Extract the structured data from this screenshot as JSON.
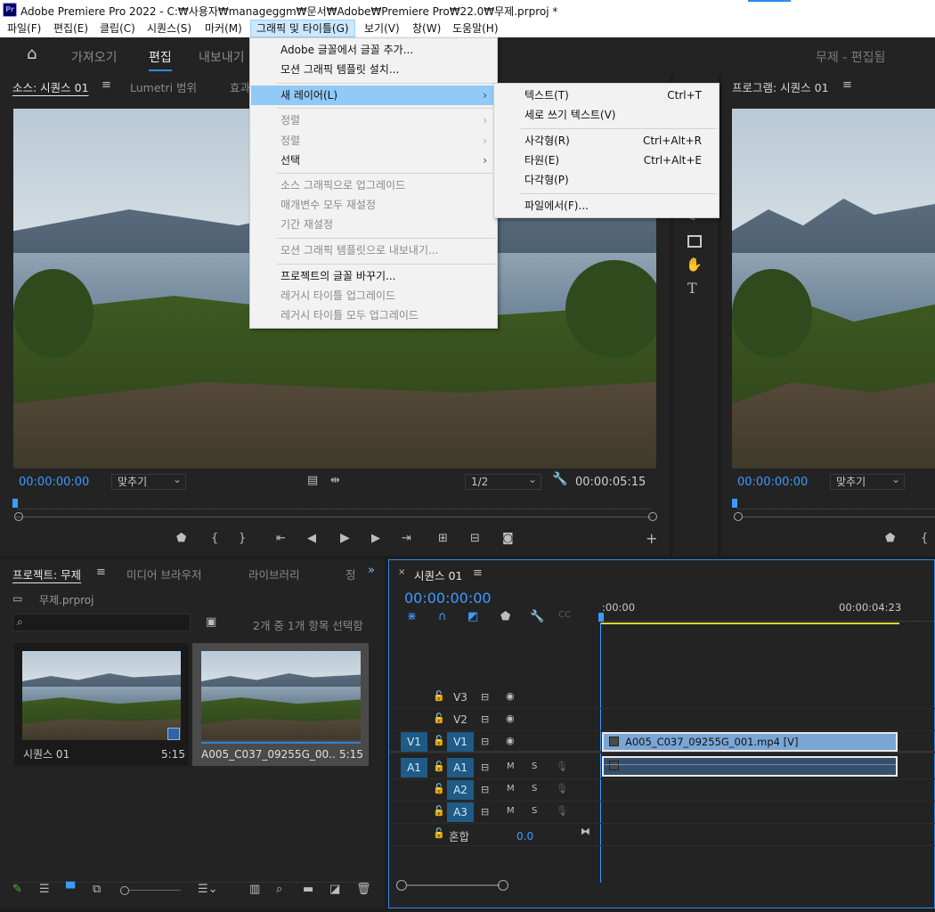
{
  "window": {
    "title": "Adobe Premiere Pro 2022 - C:₩사용자₩manageggm₩문서₩Adobe₩Premiere Pro₩22.0₩무제.prproj *",
    "app_icon": "Pr"
  },
  "menubar": [
    "파일(F)",
    "편집(E)",
    "클립(C)",
    "시퀀스(S)",
    "마커(M)",
    "그래픽 및 타이틀(G)",
    "보기(V)",
    "창(W)",
    "도움말(H)"
  ],
  "workspace": {
    "tabs": [
      "가져오기",
      "편집",
      "내보내기"
    ],
    "active": "편집",
    "project_title": "무제 - 편집됨"
  },
  "source_panel": {
    "tabs": [
      "소스: 시퀀스 01",
      "Lumetri 범위",
      "효과"
    ],
    "timecode_in": "00:00:00:00",
    "fit": "맞추기",
    "resolution": "1/2",
    "timecode_out": "00:00:05:15"
  },
  "program_panel": {
    "tab": "프로그램: 시퀀스 01",
    "timecode": "00:00:00:00",
    "fit": "맞추기"
  },
  "graphics_menu": {
    "items": [
      {
        "label": "Adobe 글꼴에서 글꼴 추가...",
        "disabled": false
      },
      {
        "label": "모션 그래픽 템플릿 설치...",
        "disabled": false
      },
      {
        "label": "새 레이어(L)",
        "disabled": false,
        "submenu": true,
        "highlight": true
      },
      {
        "label": "정렬",
        "disabled": true,
        "submenu": true
      },
      {
        "label": "정렬",
        "disabled": true,
        "submenu": true
      },
      {
        "label": "선택",
        "disabled": false,
        "submenu": true
      },
      {
        "label": "소스 그래픽으로 업그레이드",
        "disabled": true
      },
      {
        "label": "매개변수 모두 재설정",
        "disabled": true
      },
      {
        "label": "기간 재설정",
        "disabled": true
      },
      {
        "label": "모션 그래픽 템플릿으로 내보내기...",
        "disabled": true
      },
      {
        "label": "프로젝트의 글꼴 바꾸기...",
        "disabled": false
      },
      {
        "label": "레거시 타이틀 업그레이드",
        "disabled": true
      },
      {
        "label": "레거시 타이틀 모두 업그레이드",
        "disabled": true
      }
    ]
  },
  "new_layer_menu": {
    "items": [
      {
        "label": "텍스트(T)",
        "shortcut": "Ctrl+T"
      },
      {
        "label": "세로 쓰기 텍스트(V)",
        "shortcut": ""
      },
      {
        "label": "사각형(R)",
        "shortcut": "Ctrl+Alt+R"
      },
      {
        "label": "타원(E)",
        "shortcut": "Ctrl+Alt+E"
      },
      {
        "label": "다각형(P)",
        "shortcut": ""
      },
      {
        "label": "파일에서(F)...",
        "shortcut": ""
      }
    ]
  },
  "project_panel": {
    "tabs": [
      "프로젝트: 무제",
      "미디어 브라우저",
      "라이브러리",
      "정"
    ],
    "file": "무제.prproj",
    "search_placeholder": "",
    "selection_info": "2개 중 1개 항목 선택함",
    "items": [
      {
        "name": "시퀀스 01",
        "duration": "5:15"
      },
      {
        "name": "A005_C037_09255G_00...",
        "duration": "5:15"
      }
    ]
  },
  "timeline": {
    "tab": "시퀀스 01",
    "timecode": "00:00:00:00",
    "ruler_start": ":00:00",
    "ruler_end": "00:00:04:23",
    "video_tracks": [
      "V3",
      "V2",
      "V1"
    ],
    "audio_tracks": [
      "A1",
      "A2",
      "A3"
    ],
    "source_v": "V1",
    "source_a": "A1",
    "mix_label": "혼합",
    "mix_value": "0.0",
    "track_m": "M",
    "track_s": "S",
    "clip_label": "A005_C037_09255G_001.mp4 [V]"
  },
  "colors": {
    "accent": "#2d8ceb",
    "timecode": "#3c9bff",
    "menu_highlight": "#91c9f7",
    "clip_video": "#7aa6d6"
  }
}
